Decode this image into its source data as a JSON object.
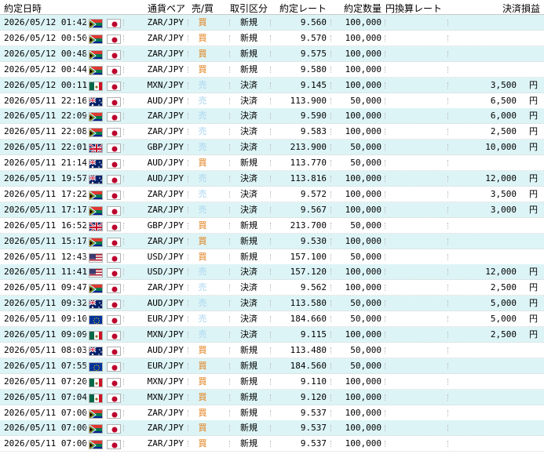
{
  "header": {
    "date": "約定日時",
    "pair": "通貨ペア",
    "side": "売/買",
    "type": "取引区分",
    "rate": "約定レート",
    "qty": "約定数量",
    "conv": "円換算レート",
    "pl": "決済損益"
  },
  "colors": {
    "buy": "#e07a10",
    "sell": "#a8d4f0",
    "row_alt": "#ddf4f6"
  },
  "rows": [
    {
      "date": "2026/05/12 01:42",
      "flag": "ZA",
      "pair": "ZAR/JPY",
      "side": "買",
      "type": "新規",
      "rate": "9.560",
      "qty": "100,000",
      "conv": "",
      "pl": "",
      "yen": ""
    },
    {
      "date": "2026/05/12 00:50",
      "flag": "ZA",
      "pair": "ZAR/JPY",
      "side": "買",
      "type": "新規",
      "rate": "9.570",
      "qty": "100,000",
      "conv": "",
      "pl": "",
      "yen": ""
    },
    {
      "date": "2026/05/12 00:48",
      "flag": "ZA",
      "pair": "ZAR/JPY",
      "side": "買",
      "type": "新規",
      "rate": "9.575",
      "qty": "100,000",
      "conv": "",
      "pl": "",
      "yen": ""
    },
    {
      "date": "2026/05/12 00:44",
      "flag": "ZA",
      "pair": "ZAR/JPY",
      "side": "買",
      "type": "新規",
      "rate": "9.580",
      "qty": "100,000",
      "conv": "",
      "pl": "",
      "yen": ""
    },
    {
      "date": "2026/05/12 00:11",
      "flag": "MX",
      "pair": "MXN/JPY",
      "side": "売",
      "type": "決済",
      "rate": "9.145",
      "qty": "100,000",
      "conv": "",
      "pl": "3,500",
      "yen": "円"
    },
    {
      "date": "2026/05/11 22:16",
      "flag": "AU",
      "pair": "AUD/JPY",
      "side": "売",
      "type": "決済",
      "rate": "113.900",
      "qty": "50,000",
      "conv": "",
      "pl": "6,500",
      "yen": "円"
    },
    {
      "date": "2026/05/11 22:09",
      "flag": "ZA",
      "pair": "ZAR/JPY",
      "side": "売",
      "type": "決済",
      "rate": "9.590",
      "qty": "100,000",
      "conv": "",
      "pl": "6,000",
      "yen": "円"
    },
    {
      "date": "2026/05/11 22:08",
      "flag": "ZA",
      "pair": "ZAR/JPY",
      "side": "売",
      "type": "決済",
      "rate": "9.583",
      "qty": "100,000",
      "conv": "",
      "pl": "2,500",
      "yen": "円"
    },
    {
      "date": "2026/05/11 22:01",
      "flag": "GB",
      "pair": "GBP/JPY",
      "side": "売",
      "type": "決済",
      "rate": "213.900",
      "qty": "50,000",
      "conv": "",
      "pl": "10,000",
      "yen": "円"
    },
    {
      "date": "2026/05/11 21:14",
      "flag": "AU",
      "pair": "AUD/JPY",
      "side": "買",
      "type": "新規",
      "rate": "113.770",
      "qty": "50,000",
      "conv": "",
      "pl": "",
      "yen": ""
    },
    {
      "date": "2026/05/11 19:57",
      "flag": "AU",
      "pair": "AUD/JPY",
      "side": "売",
      "type": "決済",
      "rate": "113.816",
      "qty": "100,000",
      "conv": "",
      "pl": "12,000",
      "yen": "円"
    },
    {
      "date": "2026/05/11 17:22",
      "flag": "ZA",
      "pair": "ZAR/JPY",
      "side": "売",
      "type": "決済",
      "rate": "9.572",
      "qty": "100,000",
      "conv": "",
      "pl": "3,500",
      "yen": "円"
    },
    {
      "date": "2026/05/11 17:17",
      "flag": "ZA",
      "pair": "ZAR/JPY",
      "side": "売",
      "type": "決済",
      "rate": "9.567",
      "qty": "100,000",
      "conv": "",
      "pl": "3,000",
      "yen": "円"
    },
    {
      "date": "2026/05/11 16:52",
      "flag": "GB",
      "pair": "GBP/JPY",
      "side": "買",
      "type": "新規",
      "rate": "213.700",
      "qty": "50,000",
      "conv": "",
      "pl": "",
      "yen": ""
    },
    {
      "date": "2026/05/11 15:17",
      "flag": "ZA",
      "pair": "ZAR/JPY",
      "side": "買",
      "type": "新規",
      "rate": "9.530",
      "qty": "100,000",
      "conv": "",
      "pl": "",
      "yen": ""
    },
    {
      "date": "2026/05/11 12:43",
      "flag": "US",
      "pair": "USD/JPY",
      "side": "買",
      "type": "新規",
      "rate": "157.100",
      "qty": "50,000",
      "conv": "",
      "pl": "",
      "yen": ""
    },
    {
      "date": "2026/05/11 11:41",
      "flag": "US",
      "pair": "USD/JPY",
      "side": "売",
      "type": "決済",
      "rate": "157.120",
      "qty": "100,000",
      "conv": "",
      "pl": "12,000",
      "yen": "円"
    },
    {
      "date": "2026/05/11 09:47",
      "flag": "ZA",
      "pair": "ZAR/JPY",
      "side": "売",
      "type": "決済",
      "rate": "9.562",
      "qty": "100,000",
      "conv": "",
      "pl": "2,500",
      "yen": "円"
    },
    {
      "date": "2026/05/11 09:32",
      "flag": "AU",
      "pair": "AUD/JPY",
      "side": "売",
      "type": "決済",
      "rate": "113.580",
      "qty": "50,000",
      "conv": "",
      "pl": "5,000",
      "yen": "円"
    },
    {
      "date": "2026/05/11 09:10",
      "flag": "EU",
      "pair": "EUR/JPY",
      "side": "売",
      "type": "決済",
      "rate": "184.660",
      "qty": "50,000",
      "conv": "",
      "pl": "5,000",
      "yen": "円"
    },
    {
      "date": "2026/05/11 09:09",
      "flag": "MX",
      "pair": "MXN/JPY",
      "side": "売",
      "type": "決済",
      "rate": "9.115",
      "qty": "100,000",
      "conv": "",
      "pl": "2,500",
      "yen": "円"
    },
    {
      "date": "2026/05/11 08:03",
      "flag": "AU",
      "pair": "AUD/JPY",
      "side": "買",
      "type": "新規",
      "rate": "113.480",
      "qty": "50,000",
      "conv": "",
      "pl": "",
      "yen": ""
    },
    {
      "date": "2026/05/11 07:55",
      "flag": "EU",
      "pair": "EUR/JPY",
      "side": "買",
      "type": "新規",
      "rate": "184.560",
      "qty": "50,000",
      "conv": "",
      "pl": "",
      "yen": ""
    },
    {
      "date": "2026/05/11 07:20",
      "flag": "MX",
      "pair": "MXN/JPY",
      "side": "買",
      "type": "新規",
      "rate": "9.110",
      "qty": "100,000",
      "conv": "",
      "pl": "",
      "yen": ""
    },
    {
      "date": "2026/05/11 07:04",
      "flag": "MX",
      "pair": "MXN/JPY",
      "side": "買",
      "type": "新規",
      "rate": "9.120",
      "qty": "100,000",
      "conv": "",
      "pl": "",
      "yen": ""
    },
    {
      "date": "2026/05/11 07:00",
      "flag": "ZA",
      "pair": "ZAR/JPY",
      "side": "買",
      "type": "新規",
      "rate": "9.537",
      "qty": "100,000",
      "conv": "",
      "pl": "",
      "yen": ""
    },
    {
      "date": "2026/05/11 07:00",
      "flag": "ZA",
      "pair": "ZAR/JPY",
      "side": "買",
      "type": "新規",
      "rate": "9.537",
      "qty": "100,000",
      "conv": "",
      "pl": "",
      "yen": ""
    },
    {
      "date": "2026/05/11 07:00",
      "flag": "ZA",
      "pair": "ZAR/JPY",
      "side": "買",
      "type": "新規",
      "rate": "9.537",
      "qty": "100,000",
      "conv": "",
      "pl": "",
      "yen": ""
    }
  ]
}
